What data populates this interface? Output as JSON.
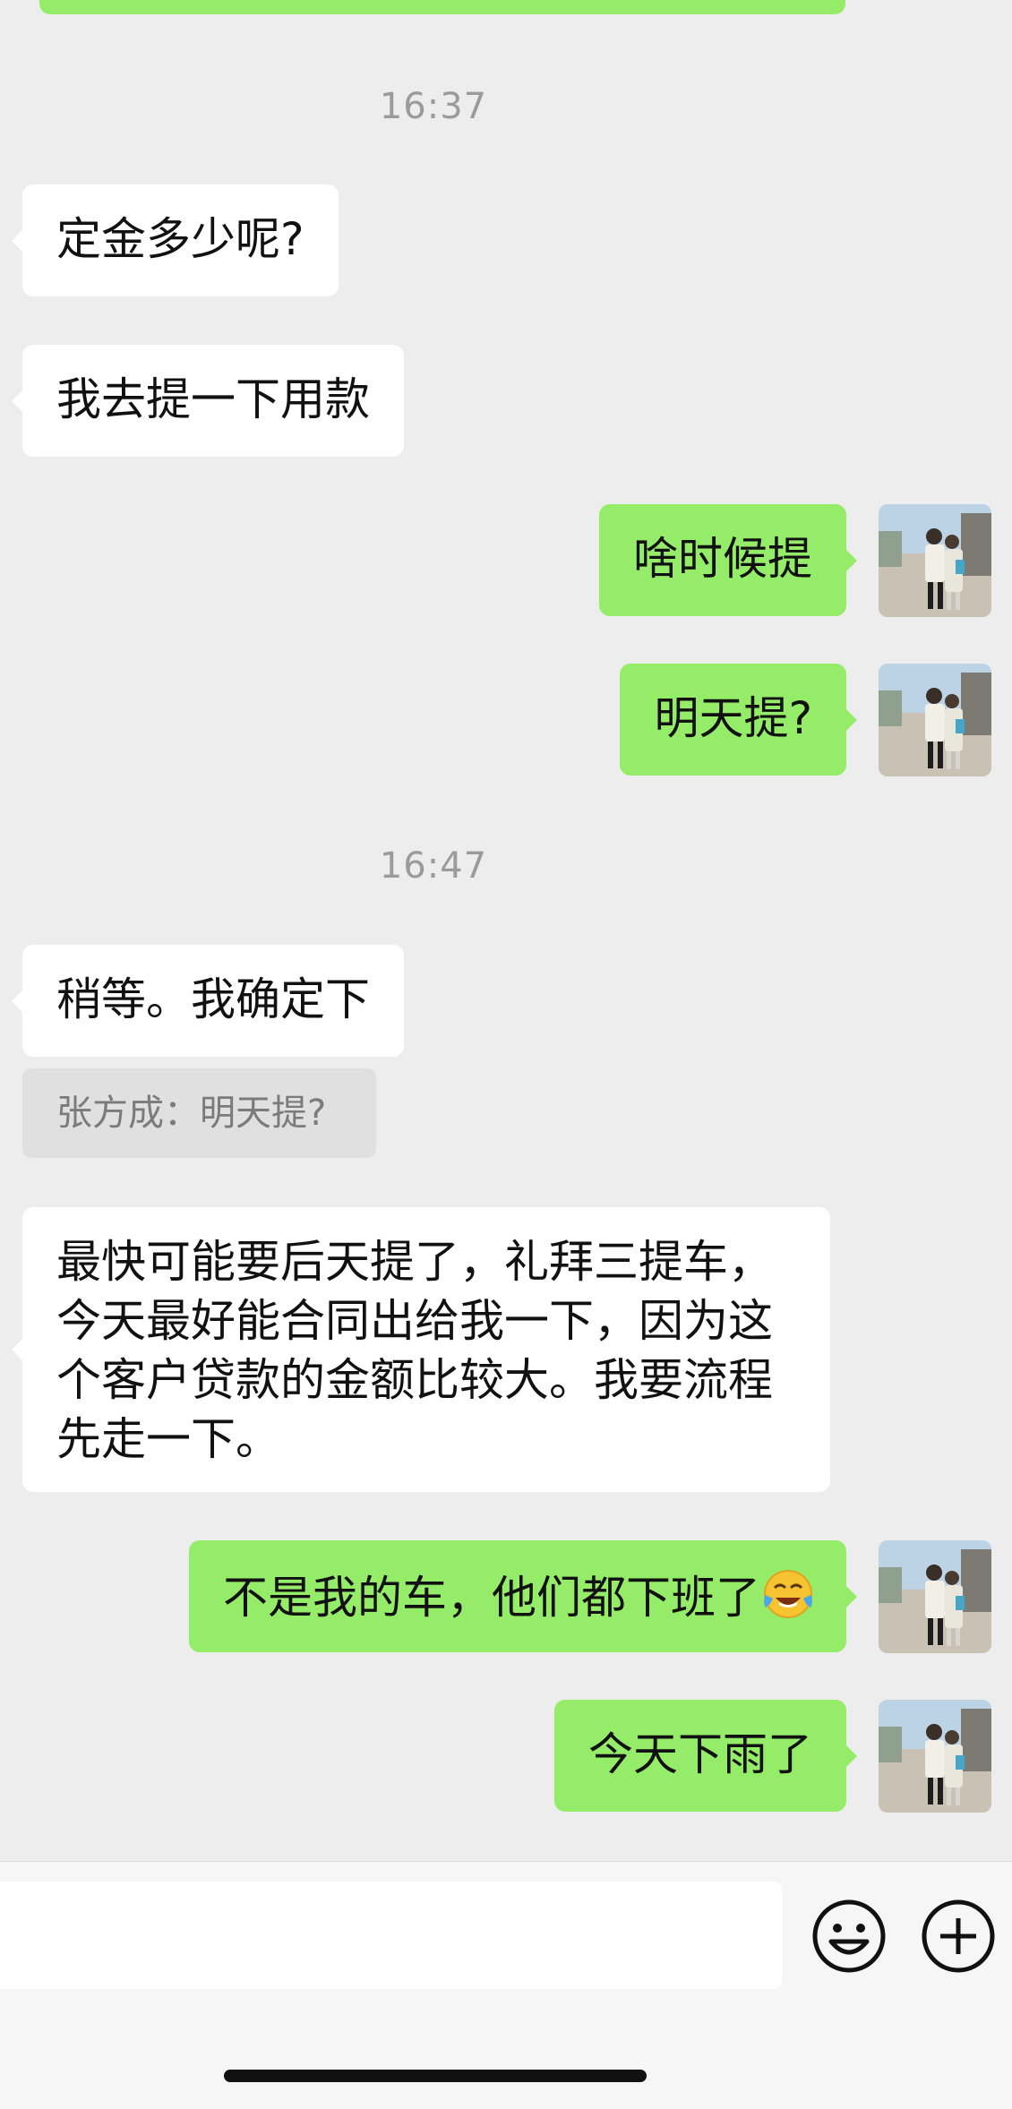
{
  "colors": {
    "background": "#ededed",
    "incoming_bubble": "#ffffff",
    "outgoing_bubble": "#95ec69",
    "timestamp": "#9b9b9b",
    "quote_bg": "#e0e0e0"
  },
  "timestamps": [
    "16:37",
    "16:47"
  ],
  "messages": [
    {
      "side": "in",
      "text": "定金多少呢?"
    },
    {
      "side": "in",
      "text": "我去提一下用款"
    },
    {
      "side": "out",
      "text": "啥时候提"
    },
    {
      "side": "out",
      "text": "明天提?"
    },
    {
      "side": "in",
      "text": "稍等。我确定下"
    },
    {
      "side": "in",
      "text": "最快可能要后天提了，礼拜三提车，今天最好能合同出给我一下，因为这个客户贷款的金额比较大。我要流程先走一下。"
    },
    {
      "side": "out",
      "text": "不是我的车，他们都下班了",
      "emoji": "face-with-tears-of-joy"
    },
    {
      "side": "out",
      "text": "今天下雨了"
    }
  ],
  "quote": {
    "text": "张方成：明天提?"
  },
  "input_bar": {
    "value": "",
    "icons": [
      "smiley-icon",
      "plus-icon"
    ]
  }
}
